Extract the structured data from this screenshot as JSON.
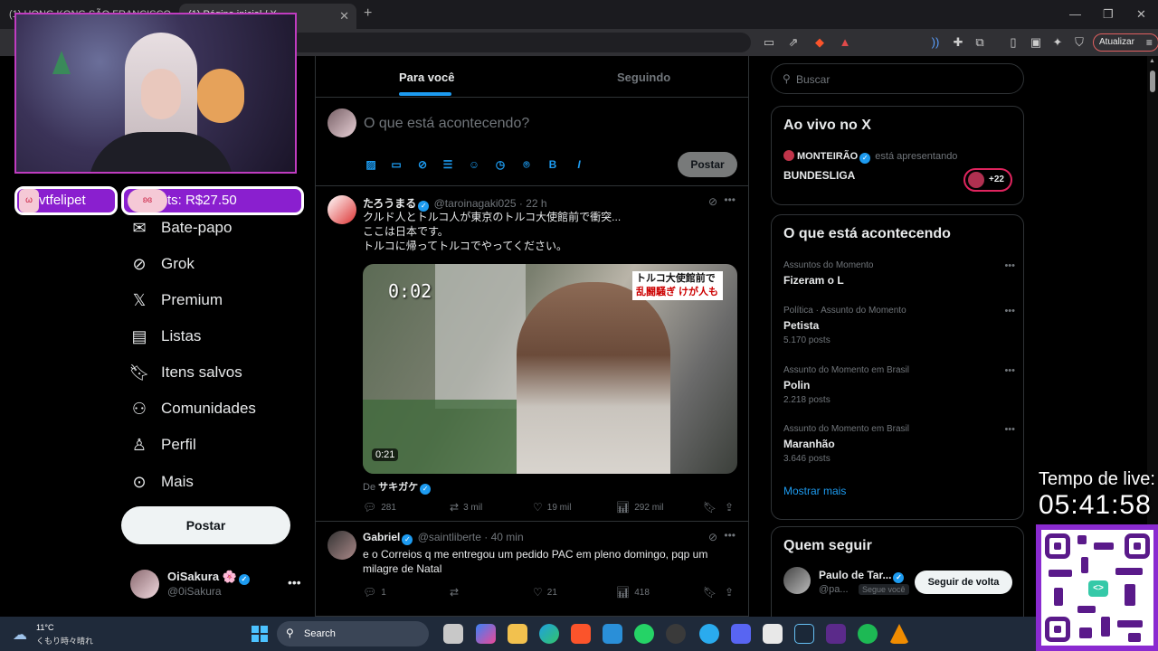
{
  "browser": {
    "tabs": [
      {
        "title": "(1) HONG KONG SÃO FRANCISCO"
      },
      {
        "title": "(1) Página inicial / X"
      }
    ],
    "update_label": "Atualizar",
    "extension_badge": "4"
  },
  "nav": {
    "items": [
      {
        "label": "Bate-papo",
        "icon": "mail-icon"
      },
      {
        "label": "Grok",
        "icon": "grok-icon"
      },
      {
        "label": "Premium",
        "icon": "x-logo-icon"
      },
      {
        "label": "Listas",
        "icon": "list-icon"
      },
      {
        "label": "Itens salvos",
        "icon": "bookmark-icon"
      },
      {
        "label": "Comunidades",
        "icon": "communities-icon"
      },
      {
        "label": "Perfil",
        "icon": "person-icon"
      },
      {
        "label": "Mais",
        "icon": "more-circle-icon"
      }
    ],
    "post_label": "Postar",
    "profile": {
      "name": "OiSakura 🌸",
      "handle": "@0iSakura"
    }
  },
  "feed": {
    "tabs": [
      "Para você",
      "Seguindo"
    ],
    "compose_placeholder": "O que está acontecendo?",
    "compose_post_label": "Postar",
    "tweets": [
      {
        "name": "たろうまる",
        "handle": "@taroinagaki025",
        "time": "22 h",
        "lines": [
          "クルド人とトルコ人が東京のトルコ大使館前で衝突...",
          "ここは日本です。",
          "トルコに帰ってトルコでやってください。"
        ],
        "video": {
          "timer": "0:02",
          "caption_line1": "トルコ大使館前で",
          "caption_line2": "乱闘騒ぎ けが人も",
          "duration": "0:21"
        },
        "source_prefix": "De",
        "source_name": "サキガケ",
        "replies": "281",
        "reposts": "3 mil",
        "likes": "19 mil",
        "views": "292 mil"
      },
      {
        "name": "Gabriel",
        "handle": "@saintliberte",
        "time": "40 min",
        "lines": [
          "e o Correios q me entregou um pedido PAC em pleno domingo, pqp um",
          "milagre de Natal"
        ],
        "replies": "1",
        "reposts": "",
        "likes": "21",
        "views": "418"
      }
    ]
  },
  "sidebar": {
    "search_placeholder": "Buscar",
    "live": {
      "title": "Ao vivo no X",
      "host": "MONTEIRÃO",
      "host_suffix": "está apresentando",
      "topic": "BUNDESLIGA",
      "listeners": "+22"
    },
    "trends": {
      "title": "O que está acontecendo",
      "items": [
        {
          "context": "Assuntos do Momento",
          "topic": "Fizeram o L",
          "count": ""
        },
        {
          "context": "Política · Assunto do Momento",
          "topic": "Petista",
          "count": "5.170 posts"
        },
        {
          "context": "Assunto do Momento em Brasil",
          "topic": "Polin",
          "count": "2.218 posts"
        },
        {
          "context": "Assunto do Momento em Brasil",
          "topic": "Maranhão",
          "count": "3.646 posts"
        }
      ],
      "show_more": "Mostrar mais"
    },
    "who_to_follow": {
      "title": "Quem seguir",
      "name": "Paulo de Tar...",
      "handle": "@pa...",
      "follows_you": "Segue você",
      "button": "Seguir de volta"
    }
  },
  "overlay": {
    "alert_user": "vtfelipet",
    "alert_amount": "ts: R$27.50",
    "timer_label": "Tempo de live:",
    "timer_value": "05:41:58"
  },
  "taskbar": {
    "temperature": "11°C",
    "weather": "くもり時々晴れ",
    "search_label": "Search"
  },
  "colors": {
    "accent": "#1d9bf0",
    "background": "#000000",
    "border": "#2f3336",
    "stream_purple": "#8a1fcf"
  }
}
